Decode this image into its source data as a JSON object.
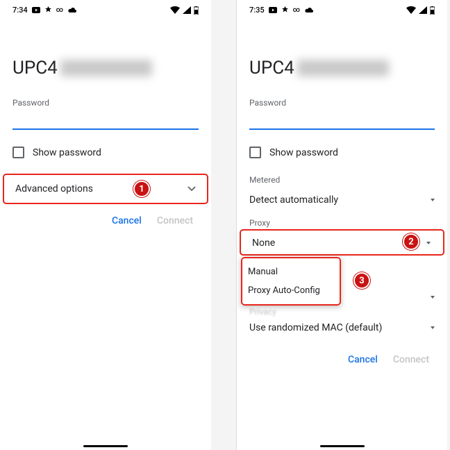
{
  "left": {
    "time": "7:34",
    "networkPrefix": "UPC4",
    "passwordLabel": "Password",
    "showPassword": "Show password",
    "advancedOptions": "Advanced options",
    "cancel": "Cancel",
    "connect": "Connect",
    "marker1": "1"
  },
  "right": {
    "time": "7:35",
    "networkPrefix": "UPC4",
    "passwordLabel": "Password",
    "showPassword": "Show password",
    "meteredLabel": "Metered",
    "meteredValue": "Detect automatically",
    "proxyLabel": "Proxy",
    "proxyValue": "None",
    "popupManual": "Manual",
    "popupAuto": "Proxy Auto-Config",
    "privacyTrunc": "Privacy",
    "privacyValue": "Use randomized MAC (default)",
    "cancel": "Cancel",
    "connect": "Connect",
    "marker2": "2",
    "marker3": "3"
  }
}
